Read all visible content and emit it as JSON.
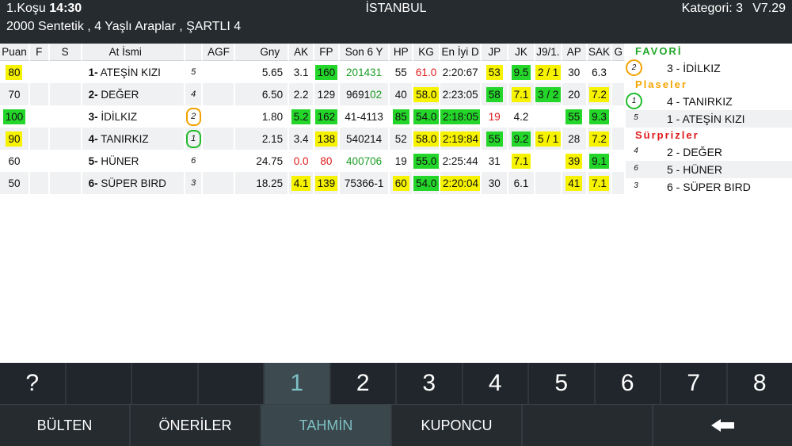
{
  "header": {
    "race_label": "1.Koşu",
    "race_time": "14:30",
    "city": "İSTANBUL",
    "category": "Kategori: 3",
    "version": "V7.29",
    "description": "2000 Sentetik , 4 Yaşlı Araplar , ŞARTLI 4"
  },
  "table": {
    "headers": [
      "Puan",
      "F",
      "S",
      "At İsmi",
      "",
      "AGF",
      "Gny",
      "AK",
      "FP",
      "Son 6 Y",
      "HP",
      "KG",
      "En İyi D",
      "JP",
      "JK",
      "J9/1.",
      "AP",
      "SAK",
      "G"
    ],
    "rows": [
      {
        "puan": "80",
        "no": "1-",
        "name": "ATEŞİN KIZI",
        "agf": "5",
        "gny": "5.65",
        "ak": "3.1",
        "fp": "160",
        "son6_a": "",
        "son6_b": "201431",
        "hp": "55",
        "kg": "61.0",
        "eniyi": "2:20:67",
        "jp": "53",
        "jk": "9.5",
        "j9": "2 / 1",
        "ap": "30",
        "sak": "6.3"
      },
      {
        "puan": "70",
        "no": "2-",
        "name": "DEĞER",
        "agf": "4",
        "gny": "6.50",
        "ak": "2.2",
        "fp": "129",
        "son6_a": "9691",
        "son6_b": "02",
        "hp": "40",
        "kg": "58.0",
        "eniyi": "2:23:05",
        "jp": "58",
        "jk": "7.1",
        "j9": "3 / 2",
        "ap": "20",
        "sak": "7.2"
      },
      {
        "puan": "100",
        "no": "3-",
        "name": "İDİLKIZ",
        "agf": "2",
        "gny": "1.80",
        "ak": "5.2",
        "fp": "162",
        "son6_a": "41-4113",
        "son6_b": "",
        "hp": "85",
        "kg": "54.0",
        "eniyi": "2:18:05",
        "jp": "19",
        "jk": "4.2",
        "j9": "",
        "ap": "55",
        "sak": "9.3"
      },
      {
        "puan": "90",
        "no": "4-",
        "name": "TANIRKIZ",
        "agf": "1",
        "gny": "2.15",
        "ak": "3.4",
        "fp": "138",
        "son6_a": "540214",
        "son6_b": "",
        "hp": "52",
        "kg": "58.0",
        "eniyi": "2:19:84",
        "jp": "55",
        "jk": "9.2",
        "j9": "5 / 1",
        "ap": "28",
        "sak": "7.2"
      },
      {
        "puan": "60",
        "no": "5-",
        "name": "HÜNER",
        "agf": "6",
        "gny": "24.75",
        "ak": "0.0",
        "fp": "80",
        "son6_a": "400706",
        "son6_b": "",
        "hp": "19",
        "kg": "55.0",
        "eniyi": "2:25:44",
        "jp": "31",
        "jk": "7.1",
        "j9": "",
        "ap": "39",
        "sak": "9.1"
      },
      {
        "puan": "50",
        "no": "6-",
        "name": "SÜPER BIRD",
        "agf": "3",
        "gny": "18.25",
        "ak": "4.1",
        "fp": "139",
        "son6_a": "75366-1",
        "son6_b": "",
        "hp": "60",
        "kg": "54.0",
        "eniyi": "2:20:04",
        "jp": "30",
        "jk": "6.1",
        "j9": "",
        "ap": "41",
        "sak": "7.1"
      }
    ]
  },
  "panel": {
    "favori_label": "FAVORİ",
    "plaseler_label": "Plaseler",
    "surprizler_label": "Sürprizler",
    "favori": [
      {
        "num": "2",
        "horse": "3 - İDİLKIZ"
      }
    ],
    "plaseler": [
      {
        "num": "1",
        "horse": "4 - TANIRKIZ"
      },
      {
        "num": "5",
        "horse": "1 - ATEŞİN KIZI"
      }
    ],
    "surprizler": [
      {
        "num": "4",
        "horse": "2 - DEĞER"
      },
      {
        "num": "6",
        "horse": "5 - HÜNER"
      },
      {
        "num": "3",
        "horse": "6 - SÜPER BIRD"
      }
    ]
  },
  "numbar": [
    "?",
    "",
    "",
    "",
    "1",
    "2",
    "3",
    "4",
    "5",
    "6",
    "7",
    "8"
  ],
  "tabs": {
    "bulten": "BÜLTEN",
    "oneriler": "ÖNERİLER",
    "tahmin": "TAHMİN",
    "kuponcu": "KUPONCU"
  },
  "colors": {
    "yellow": "#f6f200",
    "green": "#24d52a",
    "red": "#e0191b",
    "active_text": "#7ec0c4"
  }
}
